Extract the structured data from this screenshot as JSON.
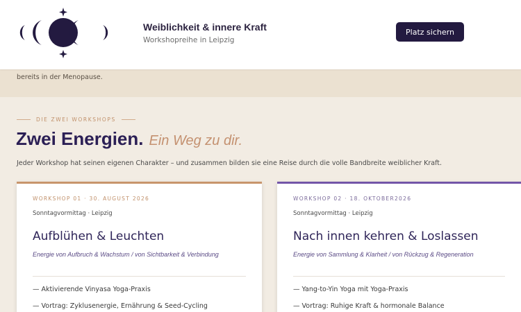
{
  "header": {
    "brand_title": "Weiblichkeit & innere Kraft",
    "brand_subtitle": "Workshopreihe in Leipzig",
    "cta_label": "Platz sichern",
    "logo_icon": "moon-phases-icon"
  },
  "intro": {
    "text": "bereits in der Menopause."
  },
  "section": {
    "eyebrow": "DIE ZWEI WORKSHOPS",
    "heading_main": "Zwei Energien.",
    "heading_accent": "Ein Weg zu dir.",
    "description": "Jeder Workshop hat seinen eigenen Charakter – und zusammen bilden sie eine Reise durch die volle Bandbreite weiblicher Kraft."
  },
  "workshops": [
    {
      "label": "WORKSHOP 01 · 30. AUGUST 2026",
      "meta": "Sonntagvormittag · Leipzig",
      "title": "Aufblühen & Leuchten",
      "tagline": "Energie von Aufbruch & Wachstum / von Sichtbarkeit & Verbindung",
      "items": [
        "— Aktivierende Vinyasa Yoga-Praxis",
        "— Vortrag: Zyklusenergie, Ernährung & Seed-Cycling"
      ],
      "accent_color": "#c8956c"
    },
    {
      "label": "WORKSHOP 02 · 18. OKTOBER2026",
      "meta": "Sonntagvormittag · Leipzig",
      "title": "Nach innen kehren & Loslassen",
      "tagline": "Energie von Sammlung & Klarheit / von Rückzug & Regeneration",
      "items": [
        "— Yang-to-Yin Yoga mit Yoga-Praxis",
        "— Vortrag: Ruhige Kraft & hormonale Balance"
      ],
      "accent_color": "#7356a8"
    }
  ],
  "colors": {
    "brand_dark": "#231a40",
    "heading_purple": "#2b1f55",
    "accent_tan": "#c49170",
    "page_bg": "#f2ece3"
  }
}
